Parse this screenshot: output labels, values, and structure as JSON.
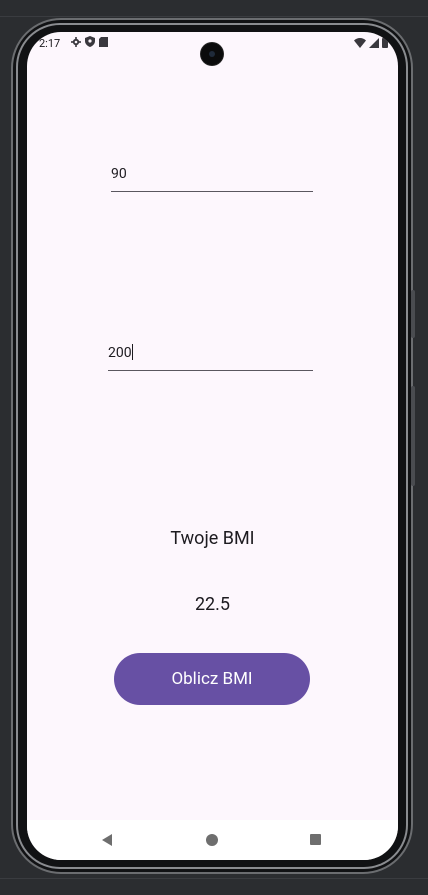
{
  "status_bar": {
    "time": "2:17",
    "left_icons": [
      "gear-icon",
      "shield-icon",
      "sd-card-icon"
    ],
    "right_icons": [
      "wifi-icon",
      "signal-icon",
      "battery-icon"
    ]
  },
  "form": {
    "weight_value": "90",
    "height_value": "200"
  },
  "result": {
    "label": "Twoje BMI",
    "value": "22.5"
  },
  "button": {
    "label": "Oblicz BMI"
  },
  "colors": {
    "primary": "#6750a4",
    "background": "#fdf7fd"
  }
}
